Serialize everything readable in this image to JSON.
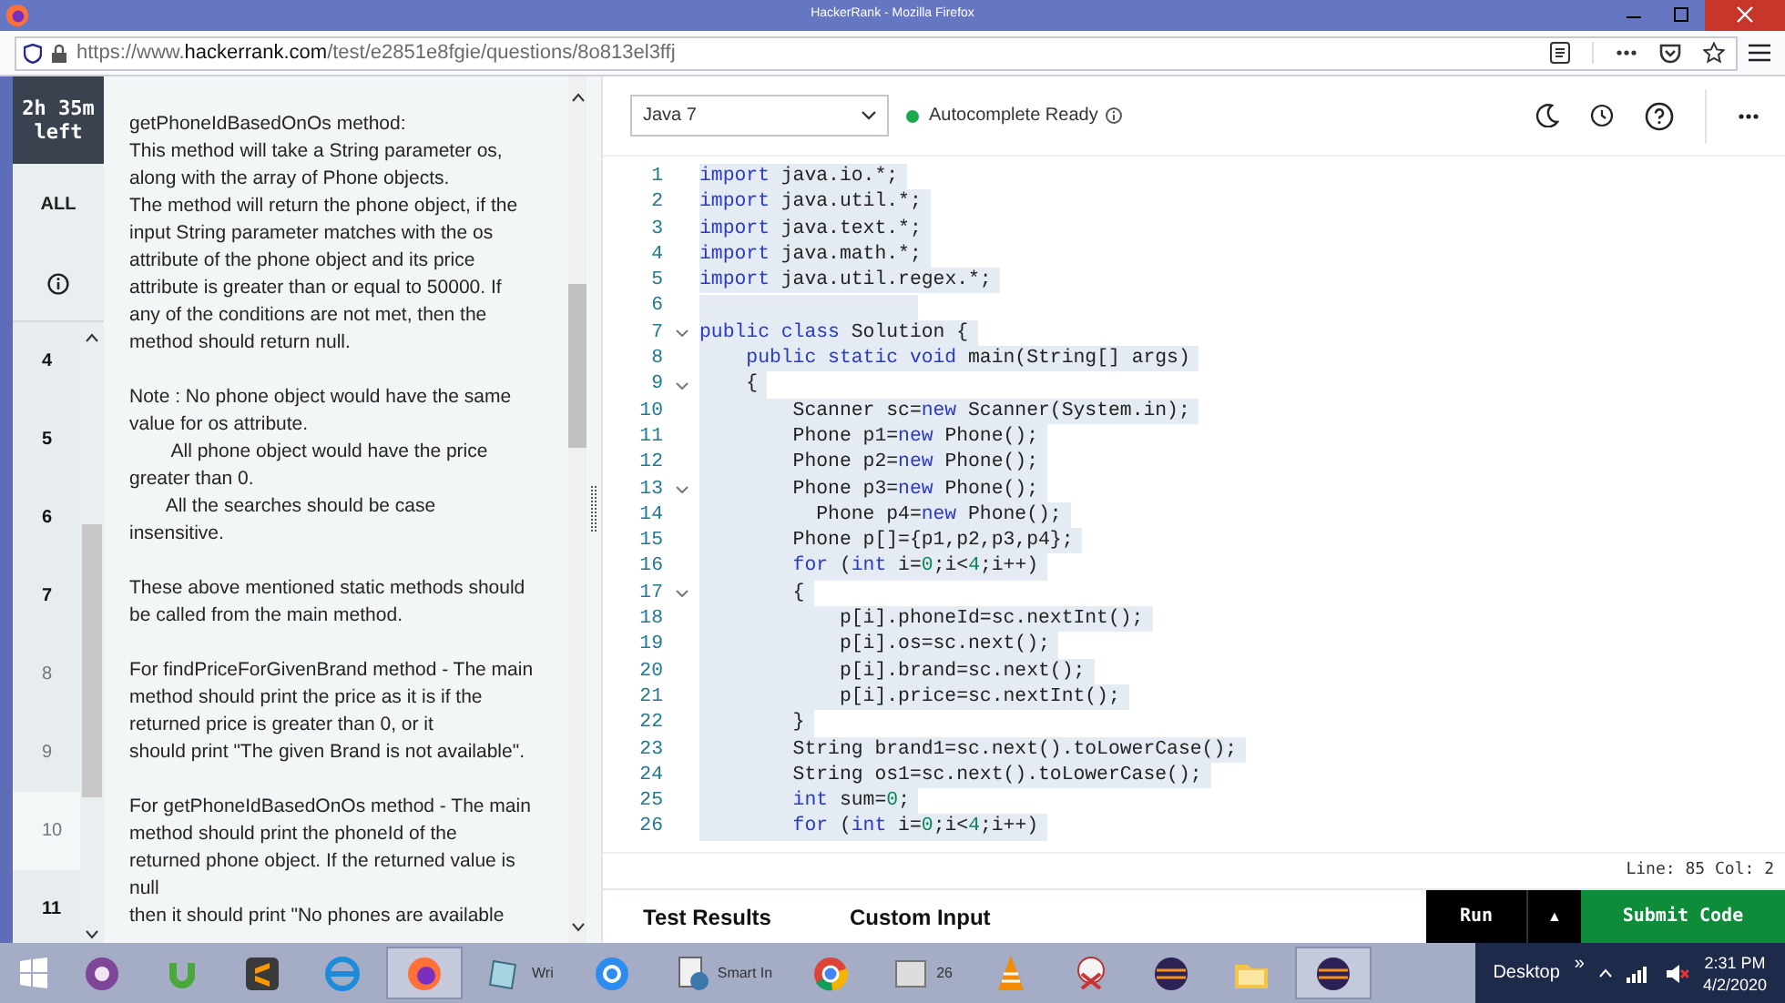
{
  "window": {
    "title": "HackerRank - Mozilla Firefox"
  },
  "address_bar": {
    "url_prefix": "https://www.",
    "url_domain": "hackerrank.com",
    "url_suffix": "/test/e2851e8fgie/questions/8o813el3ffj"
  },
  "timer": {
    "time": "2h 35m",
    "suffix": "left"
  },
  "question_nav": {
    "all_label": "ALL",
    "items": [
      {
        "label": "4",
        "selected": false,
        "attempted": true
      },
      {
        "label": "5",
        "selected": false,
        "attempted": true
      },
      {
        "label": "6",
        "selected": false,
        "attempted": true
      },
      {
        "label": "7",
        "selected": false,
        "attempted": true
      },
      {
        "label": "8",
        "selected": false,
        "attempted": false
      },
      {
        "label": "9",
        "selected": false,
        "attempted": false
      },
      {
        "label": "10",
        "selected": true,
        "attempted": false
      },
      {
        "label": "11",
        "selected": false,
        "attempted": true
      }
    ]
  },
  "question_text": [
    {
      "lines": [
        "getPhoneIdBasedOnOs method:",
        "This method will take a String parameter os,",
        "along with the array of Phone objects.",
        "The method will return the phone object, if the",
        "input String parameter matches with the os",
        "attribute of the phone object and its price",
        "attribute is greater than or equal to 50000. If",
        "any of the conditions are not met, then the",
        "method should return null."
      ]
    },
    {
      "lines": [
        "Note : No phone object would have the same",
        "value for os attribute.",
        "        All phone object would have the price",
        "greater than 0.",
        "       All the searches should be case",
        "insensitive."
      ]
    },
    {
      "lines": [
        "These above mentioned static methods should",
        "be called from the main method."
      ]
    },
    {
      "lines": [
        "For findPriceForGivenBrand method - The main",
        "method should print the price as it is if the",
        "returned price is greater than 0, or it",
        "should print \"The given Brand is not available\"."
      ]
    },
    {
      "lines": [
        "For getPhoneIdBasedOnOs method - The main",
        "method should print the phoneId of the",
        "returned phone object. If the returned value is",
        "null",
        "then it should print \"No phones are available"
      ]
    }
  ],
  "editor": {
    "language": "Java 7",
    "autocomplete_status": "Autocomplete Ready",
    "lines": [
      {
        "number": "1",
        "fold": false,
        "segments": [
          {
            "kind": "keyword",
            "text": "import"
          },
          {
            "kind": "plain",
            "text": " java.io.*;"
          }
        ]
      },
      {
        "number": "2",
        "fold": false,
        "segments": [
          {
            "kind": "keyword",
            "text": "import"
          },
          {
            "kind": "plain",
            "text": " java.util.*;"
          }
        ]
      },
      {
        "number": "3",
        "fold": false,
        "segments": [
          {
            "kind": "keyword",
            "text": "import"
          },
          {
            "kind": "plain",
            "text": " java.text.*;"
          }
        ]
      },
      {
        "number": "4",
        "fold": false,
        "segments": [
          {
            "kind": "keyword",
            "text": "import"
          },
          {
            "kind": "plain",
            "text": " java.math.*;"
          }
        ]
      },
      {
        "number": "5",
        "fold": false,
        "segments": [
          {
            "kind": "keyword",
            "text": "import"
          },
          {
            "kind": "plain",
            "text": " java.util.regex.*;"
          }
        ]
      },
      {
        "number": "6",
        "fold": false
      },
      {
        "number": "7",
        "fold": true,
        "segments": [
          {
            "kind": "keyword",
            "text": "public class"
          },
          {
            "kind": "plain",
            "text": " Solution {"
          }
        ]
      },
      {
        "number": "8",
        "fold": false,
        "segments": [
          {
            "kind": "keyword",
            "text": "    public static void"
          },
          {
            "kind": "plain",
            "text": " main(String[] args)"
          }
        ]
      },
      {
        "number": "9",
        "fold": true,
        "segments": [
          {
            "kind": "plain",
            "text": "    {"
          }
        ]
      },
      {
        "number": "10",
        "fold": false,
        "segments": [
          {
            "kind": "plain",
            "text": "        Scanner sc="
          },
          {
            "kind": "keyword",
            "text": "new"
          },
          {
            "kind": "plain",
            "text": " Scanner(System.in);"
          }
        ]
      },
      {
        "number": "11",
        "fold": false,
        "segments": [
          {
            "kind": "plain",
            "text": "        Phone p1="
          },
          {
            "kind": "keyword",
            "text": "new"
          },
          {
            "kind": "plain",
            "text": " Phone();"
          }
        ]
      },
      {
        "number": "12",
        "fold": false,
        "segments": [
          {
            "kind": "plain",
            "text": "        Phone p2="
          },
          {
            "kind": "keyword",
            "text": "new"
          },
          {
            "kind": "plain",
            "text": " Phone();"
          }
        ]
      },
      {
        "number": "13",
        "fold": true,
        "segments": [
          {
            "kind": "plain",
            "text": "        Phone p3="
          },
          {
            "kind": "keyword",
            "text": "new"
          },
          {
            "kind": "plain",
            "text": " Phone();"
          }
        ]
      },
      {
        "number": "14",
        "fold": false,
        "segments": [
          {
            "kind": "plain",
            "text": "          Phone p4="
          },
          {
            "kind": "keyword",
            "text": "new"
          },
          {
            "kind": "plain",
            "text": " Phone();"
          }
        ]
      },
      {
        "number": "15",
        "fold": false,
        "segments": [
          {
            "kind": "plain",
            "text": "        Phone p[]={p1,p2,p3,p4};"
          }
        ]
      },
      {
        "number": "16",
        "fold": false,
        "segments": [
          {
            "kind": "keyword",
            "text": "        for"
          },
          {
            "kind": "plain",
            "text": " ("
          },
          {
            "kind": "keyword",
            "text": "int"
          },
          {
            "kind": "plain",
            "text": " i="
          },
          {
            "kind": "number",
            "text": "0"
          },
          {
            "kind": "plain",
            "text": ";i<"
          },
          {
            "kind": "number",
            "text": "4"
          },
          {
            "kind": "plain",
            "text": ";i++)"
          }
        ]
      },
      {
        "number": "17",
        "fold": true,
        "segments": [
          {
            "kind": "plain",
            "text": "        {"
          }
        ]
      },
      {
        "number": "18",
        "fold": false,
        "segments": [
          {
            "kind": "plain",
            "text": "            p[i].phoneId=sc.nextInt();"
          }
        ]
      },
      {
        "number": "19",
        "fold": false,
        "segments": [
          {
            "kind": "plain",
            "text": "            p[i].os=sc.next();"
          }
        ]
      },
      {
        "number": "20",
        "fold": false,
        "segments": [
          {
            "kind": "plain",
            "text": "            p[i].brand=sc.next();"
          }
        ]
      },
      {
        "number": "21",
        "fold": false,
        "segments": [
          {
            "kind": "plain",
            "text": "            p[i].price=sc.nextInt();"
          }
        ]
      },
      {
        "number": "22",
        "fold": false,
        "segments": [
          {
            "kind": "plain",
            "text": "        }"
          }
        ]
      },
      {
        "number": "23",
        "fold": false,
        "segments": [
          {
            "kind": "plain",
            "text": "        String brand1=sc.next().toLowerCase();"
          }
        ]
      },
      {
        "number": "24",
        "fold": false,
        "segments": [
          {
            "kind": "plain",
            "text": "        String os1=sc.next().toLowerCase();"
          }
        ]
      },
      {
        "number": "25",
        "fold": false,
        "segments": [
          {
            "kind": "keyword",
            "text": "        int"
          },
          {
            "kind": "plain",
            "text": " sum="
          },
          {
            "kind": "number",
            "text": "0"
          },
          {
            "kind": "plain",
            "text": ";"
          }
        ]
      },
      {
        "number": "26",
        "fold": false,
        "segments": [
          {
            "kind": "keyword",
            "text": "        for"
          },
          {
            "kind": "plain",
            "text": " ("
          },
          {
            "kind": "keyword",
            "text": "int"
          },
          {
            "kind": "plain",
            "text": " i="
          },
          {
            "kind": "number",
            "text": "0"
          },
          {
            "kind": "plain",
            "text": ";i<"
          },
          {
            "kind": "number",
            "text": "4"
          },
          {
            "kind": "plain",
            "text": ";i++)"
          }
        ]
      }
    ],
    "cursor_position": "Line: 85 Col: 2"
  },
  "bottom_bar": {
    "tabs": [
      {
        "label": "Test Results"
      },
      {
        "label": "Custom Input"
      }
    ],
    "run_label": "Run",
    "expand_label": "▲",
    "submit_label": "Submit Code"
  },
  "taskbar": {
    "items": [
      {
        "active": false
      },
      {
        "active": false
      },
      {
        "active": false
      },
      {
        "active": false
      },
      {
        "active": true
      },
      {
        "active": false,
        "label": "Wri"
      },
      {
        "active": false
      },
      {
        "active": false,
        "label": "Smart In"
      },
      {
        "active": false
      },
      {
        "active": false,
        "label": "26"
      },
      {
        "active": false
      },
      {
        "active": false
      },
      {
        "active": false
      },
      {
        "active": false
      },
      {
        "active": true
      }
    ],
    "desktop_label": "Desktop",
    "more_label": "»",
    "time": "2:31 PM",
    "date": "4/2/2020"
  }
}
